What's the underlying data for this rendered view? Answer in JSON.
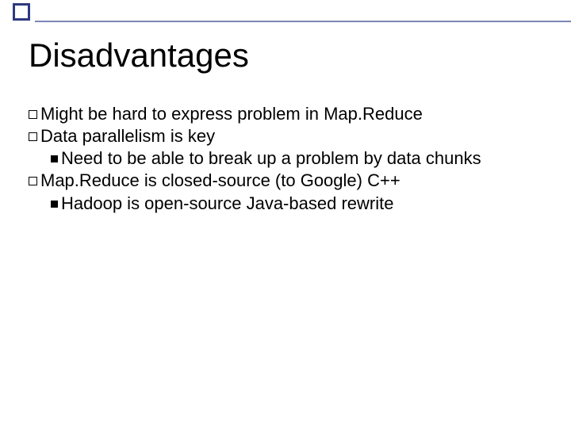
{
  "title": "Disadvantages",
  "bullets": {
    "b1": "Might be hard to express problem in Map.Reduce",
    "b2": "Data parallelism is key",
    "b2a": "Need to be able to break up a problem by data chunks",
    "b3": "Map.Reduce is closed-source (to Google) C++",
    "b3a": "Hadoop is open-source Java-based rewrite"
  }
}
